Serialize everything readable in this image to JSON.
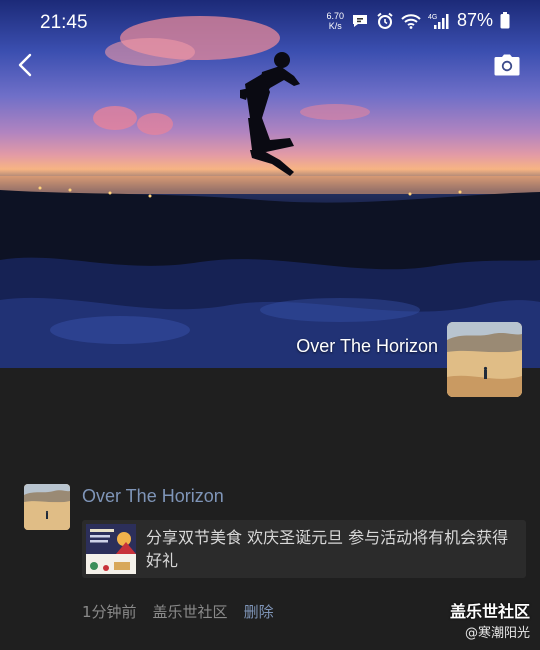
{
  "status_bar": {
    "time": "21:45",
    "net_speed_value": "6.70",
    "net_speed_unit": "K/s",
    "battery": "87%"
  },
  "nav": {
    "back_icon": "chevron-left-icon",
    "camera_icon": "camera-icon"
  },
  "profile": {
    "name": "Over The Horizon"
  },
  "post": {
    "author": "Over The Horizon",
    "share_text": "分享双节美食 欢庆圣诞元旦 参与活动将有机会获得好礼",
    "time": "1分钟前",
    "source": "盖乐世社区",
    "delete_label": "删除"
  },
  "watermark": {
    "title": "盖乐世社区",
    "user": "@寒潮阳光"
  }
}
